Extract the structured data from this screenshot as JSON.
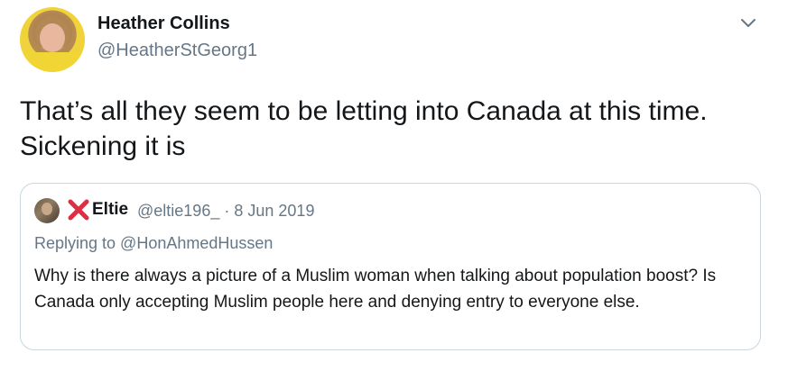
{
  "tweet": {
    "author_name": "Heather Collins",
    "author_handle": "@HeatherStGeorg1",
    "text": "That’s all they seem to be letting into Canada at this time. Sickening it is",
    "menu_icon": "chevron-down-icon"
  },
  "quoted_tweet": {
    "author_name": "Eltie",
    "author_handle": "@eltie196_",
    "separator": "·",
    "date": "8 Jun 2019",
    "replying_to": "Replying to @HonAhmedHussen",
    "text": "Why is there always a picture of a Muslim woman when talking about population boost? Is Canada only accepting Muslim people here and denying entry to everyone else.",
    "name_prefix_icon": "red-x-emoji-icon"
  },
  "colors": {
    "text_primary": "#14171a",
    "text_secondary": "#657786",
    "border": "#ccd6dd",
    "red_x": "#dd2e44"
  }
}
